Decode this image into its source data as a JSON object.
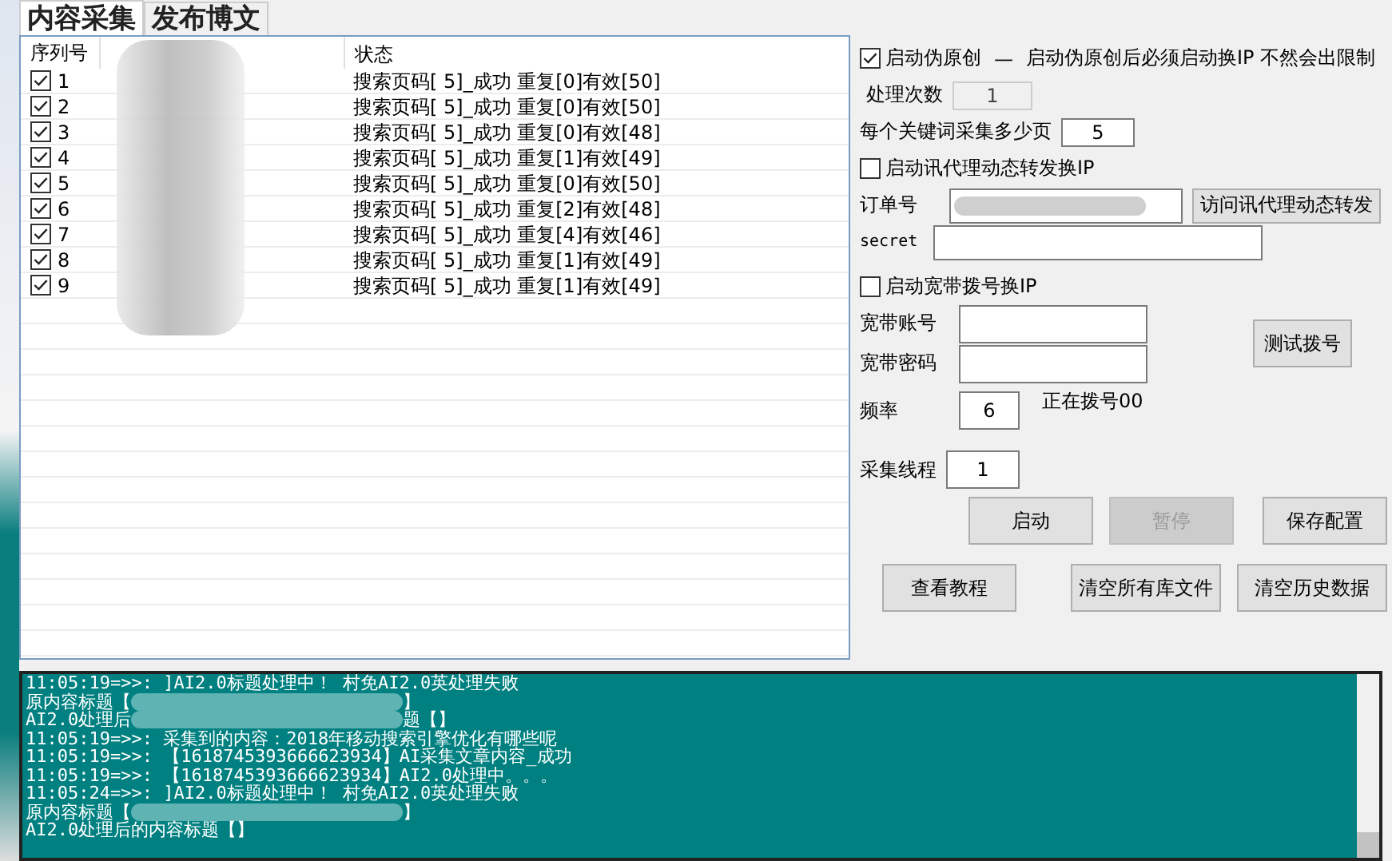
{
  "tabs": [
    {
      "label": "内容采集",
      "selected": true
    },
    {
      "label": "发布博文",
      "selected": false
    }
  ],
  "list": {
    "columns": [
      "序列号",
      "状态"
    ],
    "rows": [
      {
        "index": "1",
        "checked": true,
        "status": "搜索页码[ 5]_成功 重复[0]有效[50]"
      },
      {
        "index": "2",
        "checked": true,
        "status": "搜索页码[ 5]_成功 重复[0]有效[50]"
      },
      {
        "index": "3",
        "checked": true,
        "status": "搜索页码[ 5]_成功 重复[0]有效[48]"
      },
      {
        "index": "4",
        "checked": true,
        "status": "搜索页码[ 5]_成功 重复[1]有效[49]"
      },
      {
        "index": "5",
        "checked": true,
        "status": "搜索页码[ 5]_成功 重复[0]有效[50]"
      },
      {
        "index": "6",
        "checked": true,
        "status": "搜索页码[ 5]_成功 重复[2]有效[48]"
      },
      {
        "index": "7",
        "checked": true,
        "status": "搜索页码[ 5]_成功 重复[4]有效[46]"
      },
      {
        "index": "8",
        "checked": true,
        "status": "搜索页码[ 5]_成功 重复[1]有效[49]"
      },
      {
        "index": "9",
        "checked": true,
        "status": "搜索页码[ 5]_成功 重复[1]有效[49]"
      }
    ]
  },
  "pseudo": {
    "checked": true,
    "label": "启动伪原创",
    "separator": "—",
    "note": "启动伪原创后必须启动换IP 不然会出限制"
  },
  "process_count": {
    "label": "处理次数",
    "value": "1",
    "disabled": true
  },
  "pages": {
    "label": "每个关键词采集多少页",
    "value": "5"
  },
  "proxy": {
    "checked": false,
    "label": "启动讯代理动态转发换IP",
    "order_label": "订单号",
    "secret_label": "secret",
    "button": "访问讯代理动态转发"
  },
  "broadband": {
    "checked": false,
    "label": "启动宽带拨号换IP",
    "account_label": "宽带账号",
    "password_label": "宽带密码",
    "test_button": "测试拨号",
    "freq_label": "频率",
    "freq_value": "6",
    "status": "正在拨号00"
  },
  "threads": {
    "label": "采集线程",
    "value": "1"
  },
  "buttons": [
    {
      "label": "启动",
      "disabled": false
    },
    {
      "label": "暂停",
      "disabled": true
    },
    {
      "label": "保存配置",
      "disabled": false
    },
    {
      "label": "查看教程",
      "disabled": false
    },
    {
      "label": "清空所有库文件",
      "disabled": false
    },
    {
      "label": "清空历史数据",
      "disabled": false
    }
  ],
  "log": [
    {
      "kind": "plain",
      "text": "11:05:19=>>: ]AI2.0标题处理中！ 村免AI2.0英处理失败"
    },
    {
      "kind": "redacted",
      "before": "原内容标题【",
      "after": "】"
    },
    {
      "kind": "redacted",
      "before": "AI2.0处理后",
      "after": "题【】"
    },
    {
      "kind": "plain",
      "text": "11:05:19=>>: 采集到的内容：2018年移动搜索引擎优化有哪些呢"
    },
    {
      "kind": "plain",
      "text": "11:05:19=>>: 【1618745393666623934】AI采集文章内容_成功"
    },
    {
      "kind": "plain",
      "text": "11:05:19=>>: 【1618745393666623934】AI2.0处理中。。。"
    },
    {
      "kind": "plain",
      "text": "11:05:24=>>: ]AI2.0标题处理中！ 村免AI2.0英处理失败"
    },
    {
      "kind": "redacted",
      "before": "原内容标题【",
      "after": "】"
    },
    {
      "kind": "plain",
      "text": "AI2.0处理后的内容标题【】"
    }
  ]
}
